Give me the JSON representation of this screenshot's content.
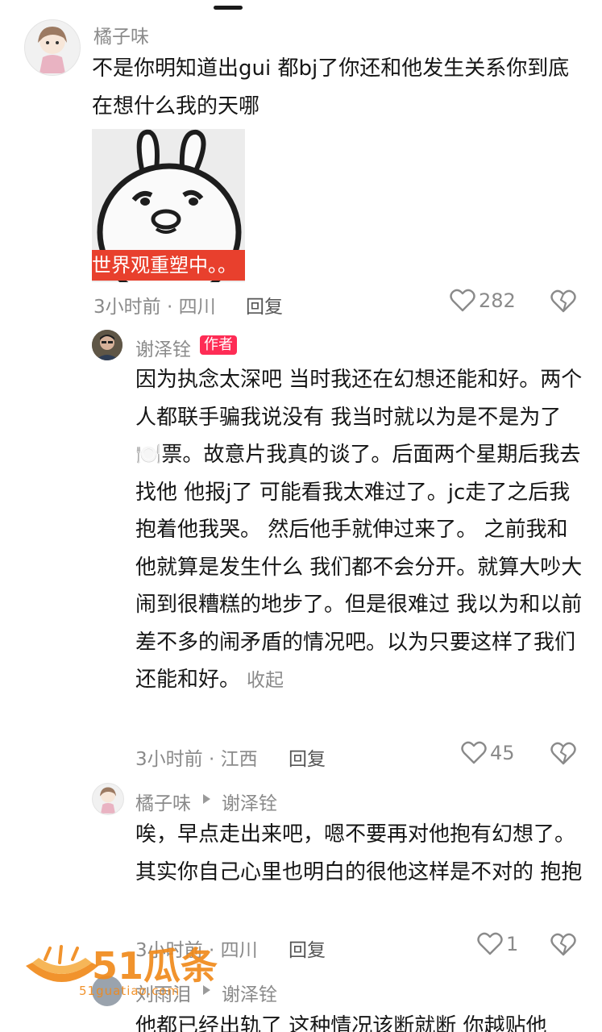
{
  "comments": [
    {
      "author": "橘子味",
      "text": "不是你明知道出gui 都bj了你还和他发生关系你到底在想什么我的天哪",
      "sticker_caption": "世界观重塑中。。",
      "time": "3小时前 · 四川",
      "reply_label": "回复",
      "likes": "282",
      "replies": [
        {
          "author": "谢泽铨",
          "author_badge": "作者",
          "text": "因为执念太深吧 当时我还在幻想还能和好。两个人都联手骗我说没有   我当时就以为是不是为了🍽️票。故意片我真的谈了。后面两个星期后我去找他 他报j了 可能看我太难过了。jc走了之后我抱着他我哭。 然后他手就伸过来了。     之前我和他就算是发生什么 我们都不会分开。就算大吵大闹到很糟糕的地步了。但是很难过    我以为和以前差不多的闹矛盾的情况吧。以为只要这样了我们还能和好。",
          "collapse_label": "收起",
          "time": "3小时前 · 江西",
          "reply_label": "回复",
          "likes": "45"
        },
        {
          "author": "橘子味",
          "reply_to": "谢泽铨",
          "text": "唉，早点走出来吧，嗯不要再对他抱有幻想了。其实你自己心里也明白的很他这样是不对的 抱抱",
          "time": "3小时前 · 四川",
          "reply_label": "回复",
          "likes": "1"
        },
        {
          "author": "刘雨泪",
          "reply_to": "谢泽铨",
          "text": "他都已经出轨了 这种情况该断就断 你越贴他"
        }
      ]
    }
  ],
  "watermark": {
    "brand": "51瓜条",
    "url": "51guatiao.com"
  }
}
